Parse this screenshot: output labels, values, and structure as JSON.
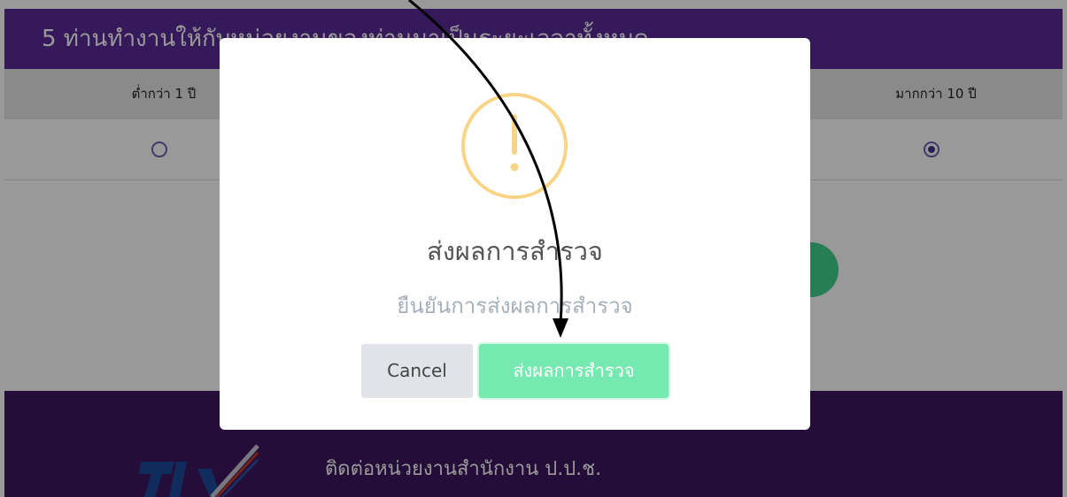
{
  "question": {
    "title": "5 ท่านทำงานให้กับหน่วยงานของท่านมาเป็นระยะเวลาทั้งหมด"
  },
  "options": [
    {
      "label": "ต่ำกว่า 1 ปี",
      "selected": false
    },
    {
      "label": "มากกว่า 10 ปี",
      "selected": true
    }
  ],
  "footer": {
    "contact_text": "ติดต่อหน่วยงานสำนักงาน ป.ป.ช."
  },
  "modal": {
    "icon": "warning-icon",
    "title": "ส่งผลการสำรวจ",
    "text": "ยืนยันการส่งผลการสำรวจ",
    "cancel_label": "Cancel",
    "confirm_label": "ส่งผลการสำรวจ"
  },
  "colors": {
    "header_bg": "#5b2a98",
    "footer_bg": "#3d1660",
    "warning": "#f8d486",
    "confirm_button": "#75e9b0",
    "cancel_button": "#e0e4e8"
  }
}
